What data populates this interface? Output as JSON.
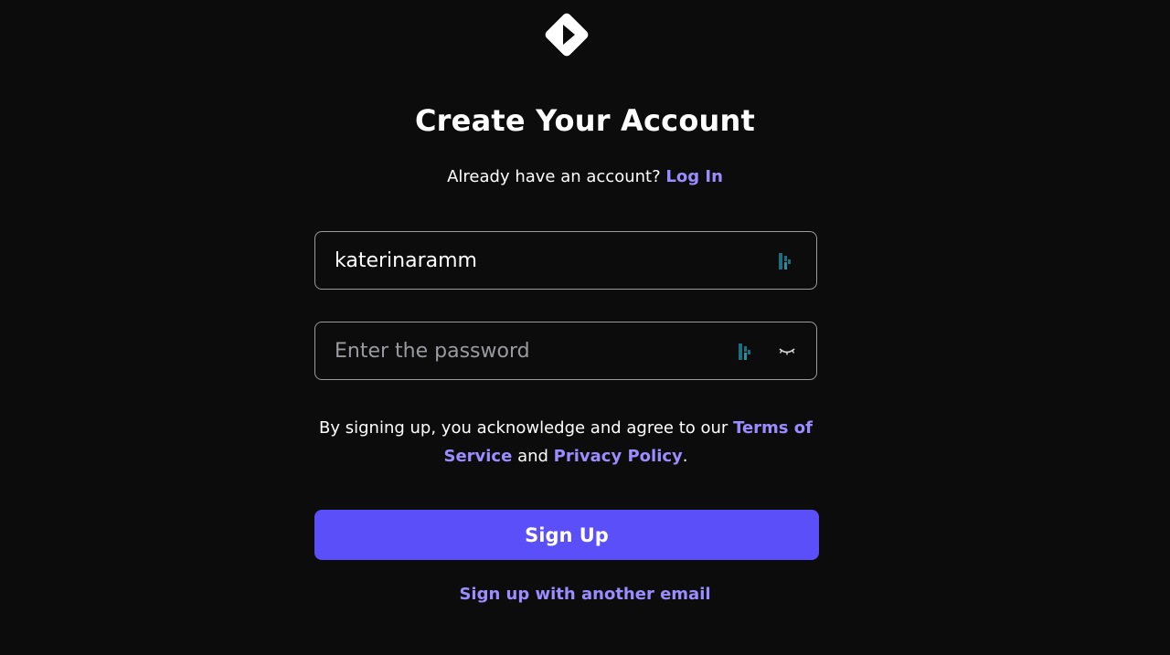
{
  "header": {
    "logo_icon": "diamond-play-logo-icon",
    "title": "Create Your Account"
  },
  "login_prompt": {
    "text": "Already have an account?",
    "link_label": "Log In"
  },
  "username_field": {
    "value": "katerinaramm",
    "icon": "password-manager-icon"
  },
  "password_field": {
    "placeholder": "Enter the password",
    "icon": "password-manager-icon",
    "toggle_icon": "eye-closed-icon"
  },
  "terms": {
    "prefix": "By signing up, you acknowledge and agree to our",
    "terms_link": "Terms of Service",
    "conjunction": "and",
    "privacy_link": "Privacy Policy",
    "suffix": "."
  },
  "actions": {
    "signup_label": "Sign Up",
    "other_email_label": "Sign up with another email"
  },
  "colors": {
    "background": "#0c0c0d",
    "accent": "#5b4ff9",
    "link": "#9b8cff",
    "border": "#9a9a9f",
    "icon_teal": "#1f6e80"
  }
}
